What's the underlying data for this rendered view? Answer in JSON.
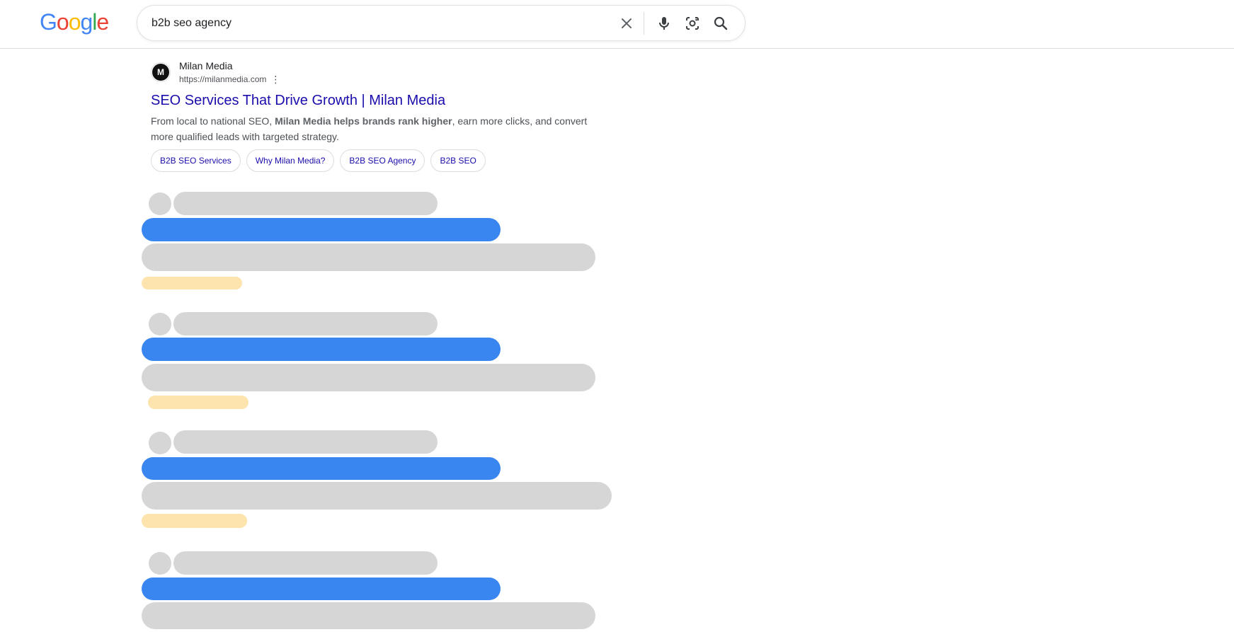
{
  "logo": {
    "letters": [
      "G",
      "o",
      "o",
      "g",
      "l",
      "e"
    ],
    "colors": [
      "#4285F4",
      "#EA4335",
      "#FBBC05",
      "#4285F4",
      "#34A853",
      "#EA4335"
    ]
  },
  "search": {
    "query": "b2b seo agency",
    "icons": [
      "close-icon",
      "mic-icon",
      "camera-lens-icon",
      "search-icon"
    ]
  },
  "result": {
    "favicon_letter": "M",
    "site_name": "Milan Media",
    "site_url": "https://milanmedia.com",
    "more_icon": "⋮",
    "title": "SEO Services That Drive Growth | Milan Media",
    "snippet_before": "From local to national SEO, ",
    "snippet_bold": "Milan Media helps brands rank higher",
    "snippet_after": ", earn more clicks, and convert more qualified leads with targeted strategy.",
    "sitelinks": [
      "B2B SEO Services",
      "Why Milan Media?",
      "B2B SEO Agency",
      "B2B SEO"
    ]
  },
  "colors": {
    "link": "#1a0dab",
    "skeleton_gray": "#d6d6d6",
    "skeleton_blue": "#3a86f0",
    "skeleton_yellow": "#fde3ac"
  }
}
